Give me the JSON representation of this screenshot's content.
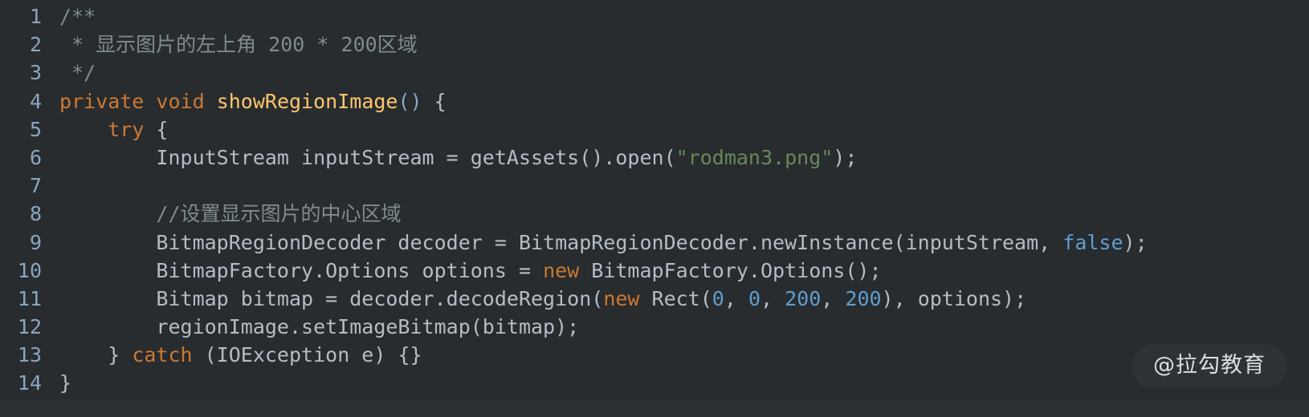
{
  "editor": {
    "language": "java",
    "theme": "darcula",
    "background_color": "#282c2f",
    "default_text_color": "#b5bcc4",
    "gutter_number_color": "#8aa5c0",
    "colors": {
      "comment": "#7f8b8d",
      "keyword": "#cc7832",
      "method_name": "#ffc66d",
      "string": "#6a8759",
      "number": "#5e9ecf",
      "constant": "#5e9ecf"
    }
  },
  "lines": [
    {
      "number": "1",
      "tokens": [
        {
          "t": "/**",
          "c": "comment"
        }
      ]
    },
    {
      "number": "2",
      "tokens": [
        {
          "t": " * 显示图片的左上角 200 * 200区域",
          "c": "comment"
        }
      ]
    },
    {
      "number": "3",
      "tokens": [
        {
          "t": " */",
          "c": "comment"
        }
      ]
    },
    {
      "number": "4",
      "tokens": [
        {
          "t": "private",
          "c": "keyword"
        },
        {
          "t": " ",
          "c": "plain"
        },
        {
          "t": "void",
          "c": "keyword"
        },
        {
          "t": " ",
          "c": "plain"
        },
        {
          "t": "showRegionImage",
          "c": "method"
        },
        {
          "t": "()",
          "c": "paren"
        },
        {
          "t": " {",
          "c": "plain"
        }
      ]
    },
    {
      "number": "5",
      "tokens": [
        {
          "t": "    ",
          "c": "plain"
        },
        {
          "t": "try",
          "c": "keyword"
        },
        {
          "t": " {",
          "c": "plain"
        }
      ]
    },
    {
      "number": "6",
      "tokens": [
        {
          "t": "        InputStream inputStream = getAssets().open(",
          "c": "plain"
        },
        {
          "t": "\"rodman3.png\"",
          "c": "string"
        },
        {
          "t": ");",
          "c": "plain"
        }
      ]
    },
    {
      "number": "7",
      "tokens": [
        {
          "t": "",
          "c": "plain"
        }
      ]
    },
    {
      "number": "8",
      "tokens": [
        {
          "t": "        ",
          "c": "plain"
        },
        {
          "t": "//设置显示图片的中心区域",
          "c": "comment"
        }
      ]
    },
    {
      "number": "9",
      "tokens": [
        {
          "t": "        BitmapRegionDecoder decoder = BitmapRegionDecoder.newInstance(inputStream, ",
          "c": "plain"
        },
        {
          "t": "false",
          "c": "const"
        },
        {
          "t": ");",
          "c": "plain"
        }
      ]
    },
    {
      "number": "10",
      "tokens": [
        {
          "t": "        BitmapFactory.Options options = ",
          "c": "plain"
        },
        {
          "t": "new",
          "c": "keyword"
        },
        {
          "t": " BitmapFactory.Options();",
          "c": "plain"
        }
      ]
    },
    {
      "number": "11",
      "tokens": [
        {
          "t": "        Bitmap bitmap = decoder.decodeRegion(",
          "c": "plain"
        },
        {
          "t": "new",
          "c": "keyword"
        },
        {
          "t": " Rect(",
          "c": "plain"
        },
        {
          "t": "0",
          "c": "number"
        },
        {
          "t": ", ",
          "c": "plain"
        },
        {
          "t": "0",
          "c": "number"
        },
        {
          "t": ", ",
          "c": "plain"
        },
        {
          "t": "200",
          "c": "number"
        },
        {
          "t": ", ",
          "c": "plain"
        },
        {
          "t": "200",
          "c": "number"
        },
        {
          "t": "), options);",
          "c": "plain"
        }
      ]
    },
    {
      "number": "12",
      "tokens": [
        {
          "t": "        regionImage.setImageBitmap(bitmap);",
          "c": "plain"
        }
      ]
    },
    {
      "number": "13",
      "tokens": [
        {
          "t": "    } ",
          "c": "plain"
        },
        {
          "t": "catch",
          "c": "keyword"
        },
        {
          "t": " (IOException e) {}",
          "c": "plain"
        }
      ]
    },
    {
      "number": "14",
      "tokens": [
        {
          "t": "}",
          "c": "plain"
        }
      ]
    }
  ],
  "watermark": {
    "label": "@拉勾教育"
  }
}
